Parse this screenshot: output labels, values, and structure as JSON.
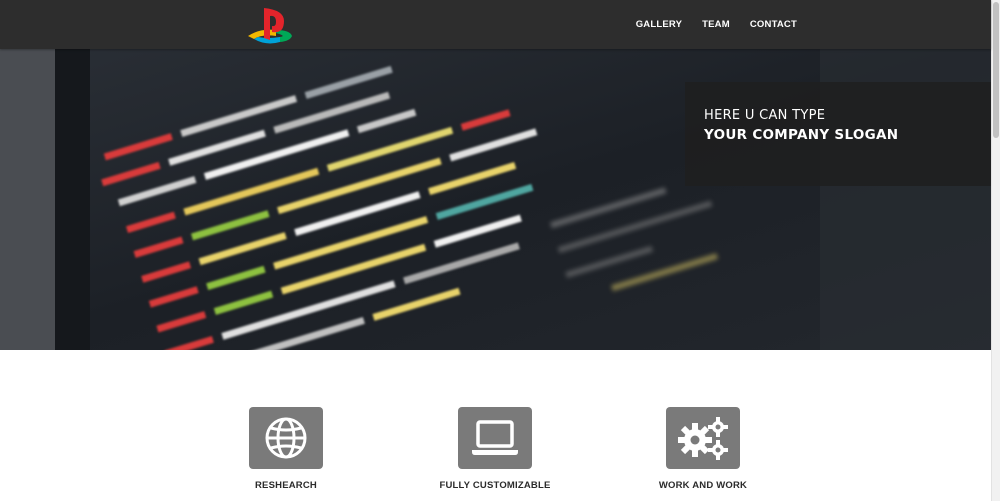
{
  "navbar": {
    "logo_icon": "playstation-logo",
    "links": [
      {
        "label": "GALLERY"
      },
      {
        "label": "TEAM"
      },
      {
        "label": "CONTACT"
      }
    ]
  },
  "hero": {
    "background": "blurred code editor photo",
    "slogan_line1": "HERE U CAN TYPE",
    "slogan_line2": "YOUR COMPANY SLOGAN"
  },
  "features": [
    {
      "icon": "globe-icon",
      "label": "RESHEARCH"
    },
    {
      "icon": "laptop-icon",
      "label": "FULLY CUSTOMIZABLE"
    },
    {
      "icon": "gears-icon",
      "label": "WORK AND WORK"
    }
  ],
  "colors": {
    "navbar_bg": "#2d2d2d",
    "icon_tile": "#7a7a7a",
    "slogan_box": "#1e1e1e"
  }
}
